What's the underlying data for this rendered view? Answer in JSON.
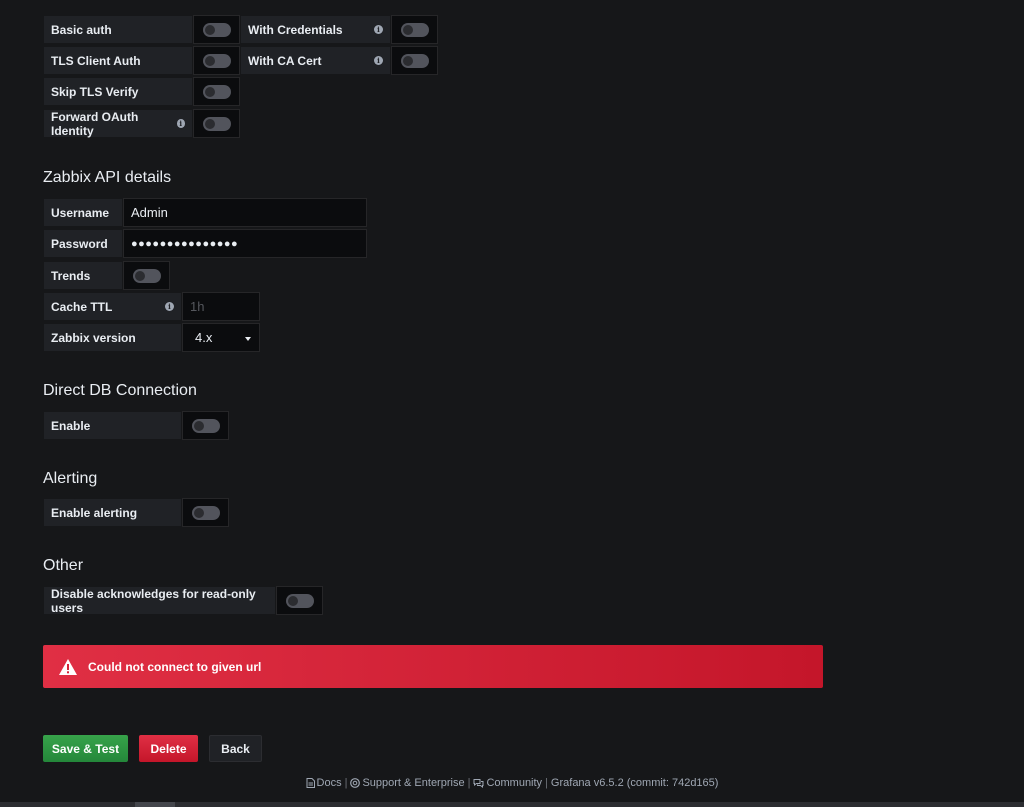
{
  "http_auth": {
    "basic_auth": "Basic auth",
    "with_credentials": "With Credentials",
    "tls_client_auth": "TLS Client Auth",
    "with_ca_cert": "With CA Cert",
    "skip_tls_verify": "Skip TLS Verify",
    "forward_oauth": "Forward OAuth Identity"
  },
  "zabbix_api": {
    "title": "Zabbix API details",
    "username_label": "Username",
    "username_value": "Admin",
    "password_label": "Password",
    "password_value": "●●●●●●●●●●●●●●●",
    "trends_label": "Trends",
    "cache_ttl_label": "Cache TTL",
    "cache_ttl_placeholder": "1h",
    "version_label": "Zabbix version",
    "version_value": "4.x"
  },
  "direct_db": {
    "title": "Direct DB Connection",
    "enable_label": "Enable"
  },
  "alerting": {
    "title": "Alerting",
    "enable_label": "Enable alerting"
  },
  "other": {
    "title": "Other",
    "disable_ack_label": "Disable acknowledges for read-only users"
  },
  "alert": {
    "message": "Could not connect to given url"
  },
  "buttons": {
    "save_test": "Save & Test",
    "delete": "Delete",
    "back": "Back"
  },
  "footer": {
    "docs": "Docs",
    "support": "Support & Enterprise",
    "community": "Community",
    "version": "Grafana v6.5.2 (commit: 742d165)",
    "separator": "|"
  },
  "colors": {
    "background": "#161719",
    "alert": "#e02f44",
    "save": "#37a34a",
    "delete": "#e02f44"
  }
}
